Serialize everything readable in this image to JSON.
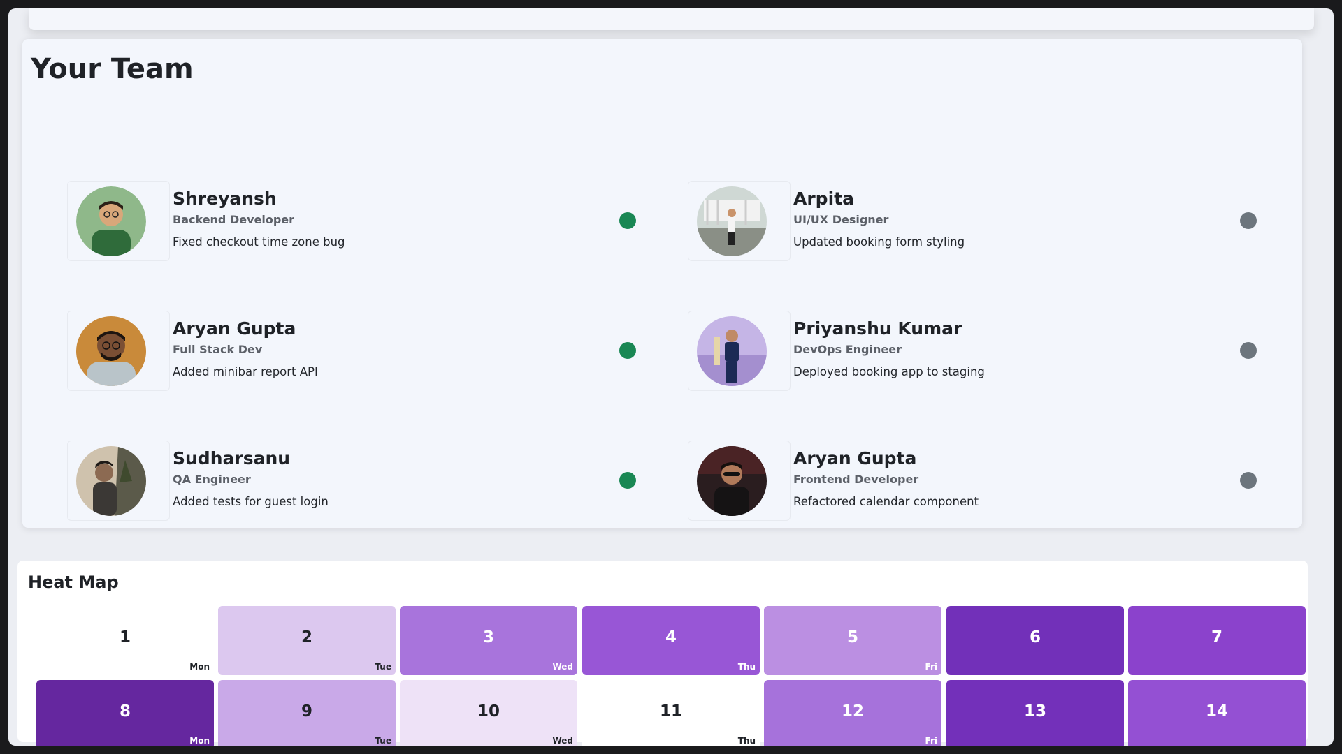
{
  "team": {
    "title": "Your Team",
    "members": [
      {
        "name": "Shreyansh",
        "role": "Backend Developer",
        "activity": "Fixed checkout time zone bug",
        "status": "online",
        "status_color": "#198754"
      },
      {
        "name": "Arpita",
        "role": "UI/UX Designer",
        "activity": "Updated booking form styling",
        "status": "offline",
        "status_color": "#6c757d"
      },
      {
        "name": "Aryan Gupta",
        "role": "Full Stack Dev",
        "activity": "Added minibar report API",
        "status": "online",
        "status_color": "#198754"
      },
      {
        "name": "Priyanshu Kumar",
        "role": "DevOps Engineer",
        "activity": "Deployed booking app to staging",
        "status": "offline",
        "status_color": "#6c757d"
      },
      {
        "name": "Sudharsanu",
        "role": "QA Engineer",
        "activity": "Added tests for guest login",
        "status": "online",
        "status_color": "#198754"
      },
      {
        "name": "Aryan Gupta",
        "role": "Frontend Developer",
        "activity": "Refactored calendar component",
        "status": "offline",
        "status_color": "#6c757d"
      }
    ]
  },
  "heatmap": {
    "title": "Heat Map",
    "cells": [
      {
        "day_number": "1",
        "weekday": "Mon",
        "color": "#ffffff"
      },
      {
        "day_number": "2",
        "weekday": "Tue",
        "color": "#dcc8ef"
      },
      {
        "day_number": "3",
        "weekday": "Wed",
        "color": "#a874dc"
      },
      {
        "day_number": "4",
        "weekday": "Thu",
        "color": "#9856d6"
      },
      {
        "day_number": "5",
        "weekday": "Fri",
        "color": "#bb8fe2"
      },
      {
        "day_number": "6",
        "weekday": "",
        "color": "#7230b9"
      },
      {
        "day_number": "7",
        "weekday": "",
        "color": "#8b42cc"
      },
      {
        "day_number": "8",
        "weekday": "Mon",
        "color": "#65279f"
      },
      {
        "day_number": "9",
        "weekday": "Tue",
        "color": "#c9a9e8"
      },
      {
        "day_number": "10",
        "weekday": "Wed",
        "color": "#eee2f7"
      },
      {
        "day_number": "11",
        "weekday": "Thu",
        "color": "#ffffff"
      },
      {
        "day_number": "12",
        "weekday": "Fri",
        "color": "#a672db"
      },
      {
        "day_number": "13",
        "weekday": "",
        "color": "#7330ba"
      },
      {
        "day_number": "14",
        "weekday": "",
        "color": "#9450d3"
      }
    ]
  }
}
